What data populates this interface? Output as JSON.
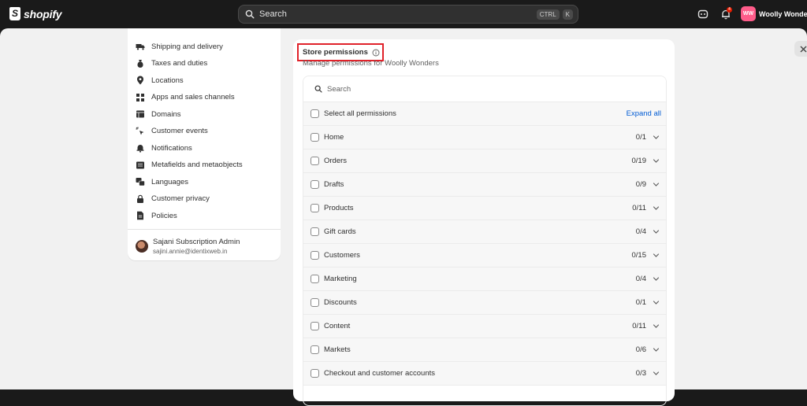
{
  "topbar": {
    "logo_text": "shopify",
    "search_placeholder": "Search",
    "shortcut_ctrl": "CTRL",
    "shortcut_k": "K",
    "notification_count": "4",
    "store_initials": "WW",
    "store_name": "Woolly Wonders"
  },
  "sidebar": {
    "items": [
      {
        "label": "Shipping and delivery",
        "icon": "truck-icon"
      },
      {
        "label": "Taxes and duties",
        "icon": "money-bag-icon"
      },
      {
        "label": "Locations",
        "icon": "location-pin-icon"
      },
      {
        "label": "Apps and sales channels",
        "icon": "apps-grid-icon"
      },
      {
        "label": "Domains",
        "icon": "globe-icon"
      },
      {
        "label": "Customer events",
        "icon": "cursor-click-icon"
      },
      {
        "label": "Notifications",
        "icon": "bell-icon"
      },
      {
        "label": "Metafields and metaobjects",
        "icon": "database-icon"
      },
      {
        "label": "Languages",
        "icon": "translate-icon"
      },
      {
        "label": "Customer privacy",
        "icon": "lock-icon"
      },
      {
        "label": "Policies",
        "icon": "document-icon"
      }
    ],
    "user": {
      "name": "Sajani Subscription Admin",
      "email": "sajini.annie@identixweb.in"
    }
  },
  "permissions": {
    "title": "Store permissions",
    "subtitle": "Manage permissions for Woolly Wonders",
    "search_placeholder": "Search",
    "select_all_label": "Select all permissions",
    "expand_all_label": "Expand all",
    "rows": [
      {
        "label": "Home",
        "count": "0/1"
      },
      {
        "label": "Orders",
        "count": "0/19"
      },
      {
        "label": "Drafts",
        "count": "0/9"
      },
      {
        "label": "Products",
        "count": "0/11"
      },
      {
        "label": "Gift cards",
        "count": "0/4"
      },
      {
        "label": "Customers",
        "count": "0/15"
      },
      {
        "label": "Marketing",
        "count": "0/4"
      },
      {
        "label": "Discounts",
        "count": "0/1"
      },
      {
        "label": "Content",
        "count": "0/11"
      },
      {
        "label": "Markets",
        "count": "0/6"
      },
      {
        "label": "Checkout and customer accounts",
        "count": "0/3"
      }
    ]
  },
  "colors": {
    "topbar_bg": "#1a1a1a",
    "canvas_bg": "#f1f1f1",
    "highlight_border": "#e0222a",
    "link_blue": "#005bd3",
    "store_avatar": "#ff5c8a"
  }
}
